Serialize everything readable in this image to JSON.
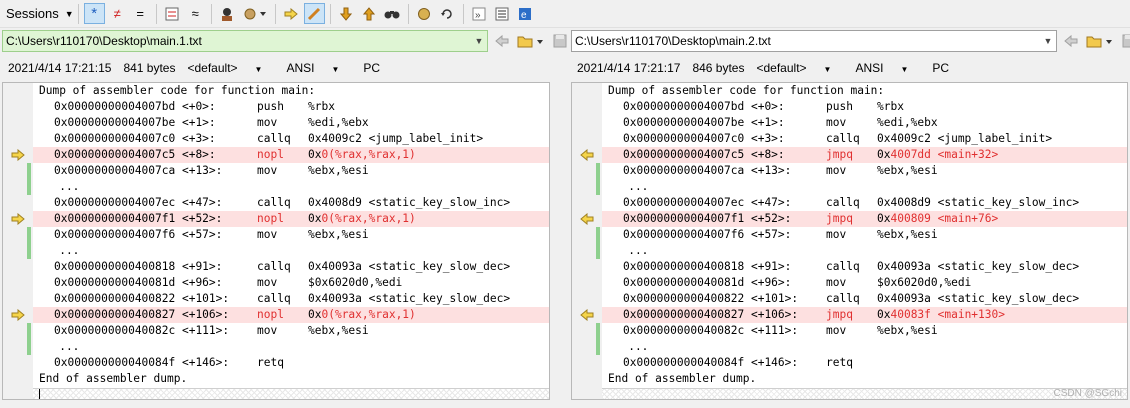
{
  "toolbar": {
    "sessions_label": "Sessions",
    "buttons": [
      {
        "icon": "star-icon",
        "glyph": "*"
      },
      {
        "icon": "not-equal-icon",
        "glyph": "≠"
      },
      {
        "icon": "equal-icon",
        "glyph": "="
      },
      {
        "icon": "diff-context-icon",
        "glyph": ""
      },
      {
        "icon": "approx-icon",
        "glyph": "≈"
      },
      {
        "icon": "ignore-icon",
        "glyph": ""
      },
      {
        "icon": "rules-icon",
        "glyph": ""
      },
      {
        "icon": "next-section-icon",
        "glyph": ""
      },
      {
        "icon": "edit-icon",
        "glyph": ""
      },
      {
        "icon": "next-diff-icon",
        "glyph": ""
      },
      {
        "icon": "prev-diff-icon",
        "glyph": ""
      },
      {
        "icon": "find-icon",
        "glyph": ""
      },
      {
        "icon": "swap-icon",
        "glyph": ""
      },
      {
        "icon": "reload-icon",
        "glyph": ""
      },
      {
        "icon": "expand-icon",
        "glyph": "»"
      },
      {
        "icon": "report-icon",
        "glyph": ""
      },
      {
        "icon": "browser-icon",
        "glyph": ""
      }
    ]
  },
  "left": {
    "path": "C:\\Users\\r110170\\Desktop\\main.1.txt",
    "info": {
      "datetime": "2021/4/14 17:21:15",
      "size": "841 bytes",
      "format": "<default>",
      "encoding": "ANSI",
      "eol": "PC"
    }
  },
  "right": {
    "path": "C:\\Users\\r110170\\Desktop\\main.2.txt",
    "info": {
      "datetime": "2021/4/14 17:21:17",
      "size": "846 bytes",
      "format": "<default>",
      "encoding": "ANSI",
      "eol": "PC"
    }
  },
  "left_lines": [
    {
      "full": "Dump of assembler code for function main:"
    },
    {
      "addr": "0x00000000004007bd <+0>:",
      "op": "push",
      "arg": "%rbx"
    },
    {
      "addr": "0x00000000004007be <+1>:",
      "op": "mov",
      "arg": "%edi,%ebx"
    },
    {
      "addr": "0x00000000004007c0 <+3>:",
      "op": "callq",
      "arg": "0x4009c2 <jump_label_init>"
    },
    {
      "addr": "0x00000000004007c5 <+8>:",
      "op": "nopl",
      "arg": "0x0(%rax,%rax,1)",
      "diff": true,
      "argPre": "0x",
      "argDiff": "0(%rax,%rax,1)"
    },
    {
      "addr": "0x00000000004007ca <+13>:",
      "op": "mov",
      "arg": "%ebx,%esi"
    },
    {
      "full": "   ..."
    },
    {
      "addr": "0x00000000004007ec <+47>:",
      "op": "callq",
      "arg": "0x4008d9 <static_key_slow_inc>"
    },
    {
      "addr": "0x00000000004007f1 <+52>:",
      "op": "nopl",
      "arg": "0x0(%rax,%rax,1)",
      "diff": true,
      "argPre": "0x",
      "argDiff": "0(%rax,%rax,1)"
    },
    {
      "addr": "0x00000000004007f6 <+57>:",
      "op": "mov",
      "arg": "%ebx,%esi"
    },
    {
      "full": "   ..."
    },
    {
      "addr": "0x0000000000400818 <+91>:",
      "op": "callq",
      "arg": "0x40093a <static_key_slow_dec>"
    },
    {
      "addr": "0x000000000040081d <+96>:",
      "op": "mov",
      "arg": "$0x6020d0,%edi"
    },
    {
      "addr": "0x0000000000400822 <+101>:",
      "op": "callq",
      "arg": "0x40093a <static_key_slow_dec>"
    },
    {
      "addr": "0x0000000000400827 <+106>:",
      "op": "nopl",
      "arg": "0x0(%rax,%rax,1)",
      "diff": true,
      "argPre": "0x",
      "argDiff": "0(%rax,%rax,1)"
    },
    {
      "addr": "0x000000000040082c <+111>:",
      "op": "mov",
      "arg": "%ebx,%esi"
    },
    {
      "full": "   ..."
    },
    {
      "addr": "0x000000000040084f <+146>:",
      "op": "retq",
      "arg": ""
    },
    {
      "full": "End of assembler dump."
    }
  ],
  "right_lines": [
    {
      "full": "Dump of assembler code for function main:"
    },
    {
      "addr": "0x00000000004007bd <+0>:",
      "op": "push",
      "arg": "%rbx"
    },
    {
      "addr": "0x00000000004007be <+1>:",
      "op": "mov",
      "arg": "%edi,%ebx"
    },
    {
      "addr": "0x00000000004007c0 <+3>:",
      "op": "callq",
      "arg": "0x4009c2 <jump_label_init>"
    },
    {
      "addr": "0x00000000004007c5 <+8>:",
      "op": "jmpq",
      "arg": "0x4007dd <main+32>",
      "diff": true,
      "argPre": "0x",
      "argDiff": "4007dd <main+32>"
    },
    {
      "addr": "0x00000000004007ca <+13>:",
      "op": "mov",
      "arg": "%ebx,%esi"
    },
    {
      "full": "   ..."
    },
    {
      "addr": "0x00000000004007ec <+47>:",
      "op": "callq",
      "arg": "0x4008d9 <static_key_slow_inc>"
    },
    {
      "addr": "0x00000000004007f1 <+52>:",
      "op": "jmpq",
      "arg": "0x400809 <main+76>",
      "diff": true,
      "argPre": "0x",
      "argDiff": "400809 <main+76>"
    },
    {
      "addr": "0x00000000004007f6 <+57>:",
      "op": "mov",
      "arg": "%ebx,%esi"
    },
    {
      "full": "   ..."
    },
    {
      "addr": "0x0000000000400818 <+91>:",
      "op": "callq",
      "arg": "0x40093a <static_key_slow_dec>"
    },
    {
      "addr": "0x000000000040081d <+96>:",
      "op": "mov",
      "arg": "$0x6020d0,%edi"
    },
    {
      "addr": "0x0000000000400822 <+101>:",
      "op": "callq",
      "arg": "0x40093a <static_key_slow_dec>"
    },
    {
      "addr": "0x0000000000400827 <+106>:",
      "op": "jmpq",
      "arg": "0x40083f <main+130>",
      "diff": true,
      "argPre": "0x",
      "argDiff": "40083f <main+130>"
    },
    {
      "addr": "0x000000000040082c <+111>:",
      "op": "mov",
      "arg": "%ebx,%esi"
    },
    {
      "full": "   ..."
    },
    {
      "addr": "0x000000000040084f <+146>:",
      "op": "retq",
      "arg": ""
    },
    {
      "full": "End of assembler dump."
    }
  ],
  "gutter_marks": [
    null,
    null,
    null,
    null,
    "arrow",
    "bar",
    "bar",
    null,
    "arrow",
    "bar",
    "bar",
    null,
    null,
    null,
    "arrow",
    "bar",
    "bar",
    null,
    null
  ],
  "watermark": "CSDN @SGchi",
  "colors": {
    "diff_bg": "#fde0e0",
    "diff_text": "#e03030",
    "path_left_bg": "#dff5d4",
    "gutter_bar": "#8ed08e",
    "arrow_fill": "#f5d54a"
  }
}
